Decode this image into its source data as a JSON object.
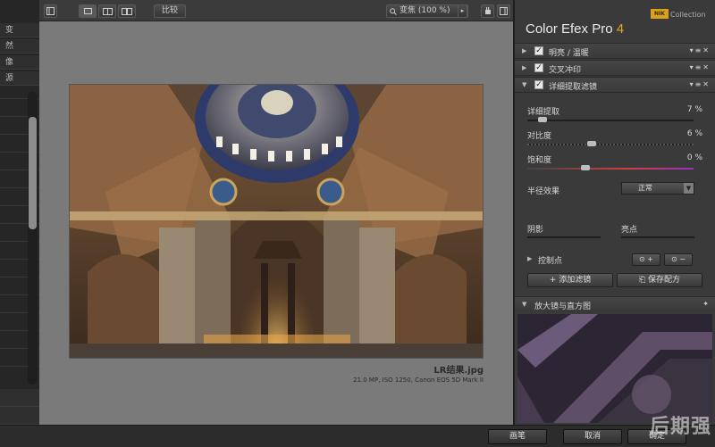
{
  "toolbar": {
    "compare_label": "比较",
    "zoom_label": "变焦 (100 %)",
    "view_modes": [
      "single-view",
      "split-view",
      "side-by-side-view"
    ]
  },
  "left_panel": {
    "items": [
      "变",
      "然",
      "像",
      "源"
    ]
  },
  "canvas": {
    "filename": "LR结果.jpg",
    "meta": "21.0 MP, ISO 1250, Canon EOS 5D Mark II"
  },
  "panel": {
    "brand": "NIK",
    "collection": "Collection",
    "title": "Color Efex Pro",
    "version": "4",
    "filters": [
      {
        "label": "明亮 / 温暖",
        "checked": true,
        "expanded": false
      },
      {
        "label": "交叉冲印",
        "checked": true,
        "expanded": false
      },
      {
        "label": "详细提取滤镜",
        "checked": true,
        "expanded": true
      }
    ],
    "sliders": [
      {
        "label": "详细提取",
        "value": "7 %",
        "level": 0.07
      },
      {
        "label": "对比度",
        "value": "6 %",
        "level": 0.38
      },
      {
        "label": "饱和度",
        "value": "0 %",
        "level": 0.34
      }
    ],
    "radius_label": "半径效果",
    "radius_value": "正常",
    "shadows_label": "阴影",
    "highlights_label": "亮点",
    "control_points_label": "控制点",
    "add_filter_label": "添加滤镜",
    "save_recipe_label": "保存配方",
    "loupe_label": "放大镜与直方图"
  },
  "bottom": {
    "brush_label": "画笔",
    "cancel_label": "取消",
    "ok_label": "确定",
    "watermark": "后期强"
  },
  "colors": {
    "accent": "#e6a520",
    "panel_bg": "#3a3a3a",
    "canvas_bg": "#7a7a7a"
  }
}
